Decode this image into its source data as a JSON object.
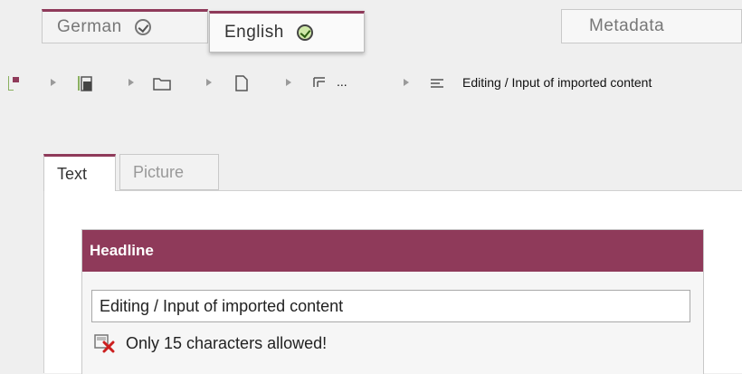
{
  "language_tabs": [
    {
      "label": "German",
      "icon": "check-circle-icon"
    },
    {
      "label": "English",
      "icon": "check-circle-green-icon"
    },
    {
      "label": "Metadata"
    }
  ],
  "breadcrumb": {
    "ellipsis": "...",
    "current": "Editing / Input of imported content"
  },
  "content_tabs": [
    {
      "label": "Text"
    },
    {
      "label": "Picture"
    }
  ],
  "section": {
    "title": "Headline",
    "input_value": "Editing / Input of imported content",
    "error_message": "Only 15 characters allowed!"
  },
  "colors": {
    "accent": "#8f3a5a",
    "check_green": "#cfe9a8",
    "error_red": "#cc1f1f"
  }
}
